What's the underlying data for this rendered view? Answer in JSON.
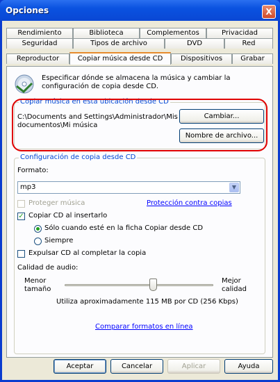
{
  "window": {
    "title": "Opciones",
    "close_label": "X"
  },
  "tabs": {
    "row1": [
      "Rendimiento",
      "Biblioteca",
      "Complementos",
      "Privacidad"
    ],
    "row2": [
      "Seguridad",
      "Tipos de archivo",
      "DVD",
      "Red"
    ],
    "row3": [
      "Reproductor",
      "Copiar música desde CD",
      "Dispositivos",
      "Grabar"
    ],
    "active": "Copiar música desde CD"
  },
  "header": {
    "description": "Especificar dónde se almacena la música y cambiar la configuración de copia desde CD."
  },
  "location_group": {
    "title": "Copiar música en esta ubicación desde CD",
    "path_line1": "C:\\Documents and Settings\\Administrador\\Mis",
    "path_line2": "documentos\\Mi música",
    "change_button": "Cambiar...",
    "filename_button": "Nombre de archivo..."
  },
  "settings_group": {
    "title": "Configuración de copia desde CD",
    "format_label": "Formato:",
    "format_value": "mp3",
    "protect_label": "Proteger música",
    "protect_checked": false,
    "protect_enabled": false,
    "protection_link": "Protección contra copias",
    "copy_on_insert_label": "Copiar CD al insertarlo",
    "copy_on_insert_checked": true,
    "radio_only_tab": "Sólo cuando esté en la ficha Copiar desde CD",
    "radio_always": "Siempre",
    "radio_selected": "only_tab",
    "eject_label": "Expulsar CD al completar la copia",
    "eject_checked": false,
    "quality_label": "Calidad de audio:",
    "quality_min_line1": "Menor",
    "quality_min_line2": "tamaño",
    "quality_max_line1": "Mejor",
    "quality_max_line2": "calidad",
    "quality_level": 0.6,
    "quality_info": "Utiliza aproximadamente 115 MB por CD (256 Kbps)",
    "compare_link": "Comparar formatos en línea"
  },
  "footer": {
    "accept": "Aceptar",
    "cancel": "Cancelar",
    "apply": "Aplicar",
    "help": "Ayuda"
  },
  "colors": {
    "group_title": "#0046d5",
    "annotation": "#e00000",
    "link": "#0000ff"
  }
}
